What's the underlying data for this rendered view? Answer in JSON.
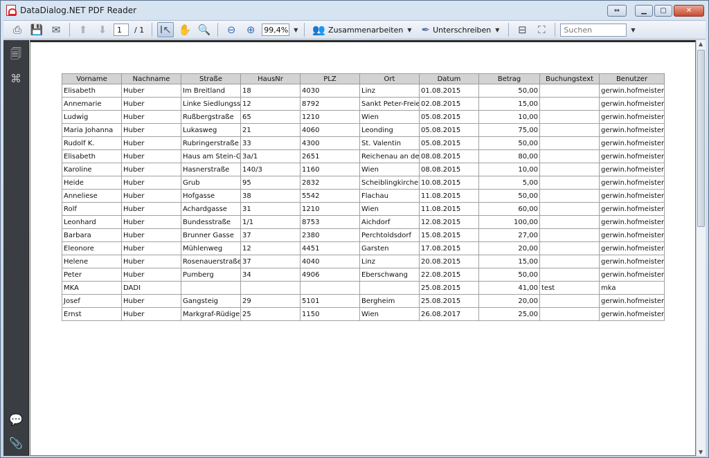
{
  "window": {
    "title": "DataDialog.NET PDF Reader"
  },
  "toolbar": {
    "page_current": "1",
    "page_total": "/ 1",
    "zoom": "99,4%",
    "collaborate_label": "Zusammenarbeiten",
    "sign_label": "Unterschreiben",
    "search_placeholder": "Suchen"
  },
  "table": {
    "headers": [
      "Vorname",
      "Nachname",
      "Straße",
      "HausNr",
      "PLZ",
      "Ort",
      "Datum",
      "Betrag",
      "Buchungstext",
      "Benutzer"
    ],
    "rows": [
      [
        "Elisabeth",
        "Huber",
        "Im Breitland",
        "18",
        "4030",
        "Linz",
        "01.08.2015",
        "50,00",
        "",
        "gerwin.hofmeister"
      ],
      [
        "Annemarie",
        "Huber",
        "Linke Siedlungsstr",
        "12",
        "8792",
        "Sankt Peter-Freien",
        "02.08.2015",
        "15,00",
        "",
        "gerwin.hofmeister"
      ],
      [
        "Ludwig",
        "Huber",
        "Rußbergstraße",
        "65",
        "1210",
        "Wien",
        "05.08.2015",
        "10,00",
        "",
        "gerwin.hofmeister"
      ],
      [
        "Maria Johanna",
        "Huber",
        "Lukasweg",
        "21",
        "4060",
        "Leonding",
        "05.08.2015",
        "75,00",
        "",
        "gerwin.hofmeister"
      ],
      [
        "Rudolf K.",
        "Huber",
        "Rubringerstraße",
        "33",
        "4300",
        "St. Valentin",
        "05.08.2015",
        "50,00",
        "",
        "gerwin.hofmeister"
      ],
      [
        "Elisabeth",
        "Huber",
        "Haus am Stein-Ga",
        "3a/1",
        "2651",
        "Reichenau an der",
        "08.08.2015",
        "80,00",
        "",
        "gerwin.hofmeister"
      ],
      [
        "Karoline",
        "Huber",
        "Hasnerstraße",
        "140/3",
        "1160",
        "Wien",
        "08.08.2015",
        "10,00",
        "",
        "gerwin.hofmeister"
      ],
      [
        "Heide",
        "Huber",
        "Grub",
        "95",
        "2832",
        "Scheiblingkirchen-",
        "10.08.2015",
        "5,00",
        "",
        "gerwin.hofmeister"
      ],
      [
        "Anneliese",
        "Huber",
        "Hofgasse",
        "38",
        "5542",
        "Flachau",
        "11.08.2015",
        "50,00",
        "",
        "gerwin.hofmeister"
      ],
      [
        "Rolf",
        "Huber",
        "Achardgasse",
        "31",
        "1210",
        "Wien",
        "11.08.2015",
        "60,00",
        "",
        "gerwin.hofmeister"
      ],
      [
        "Leonhard",
        "Huber",
        "Bundesstraße",
        "1/1",
        "8753",
        "Aichdorf",
        "12.08.2015",
        "100,00",
        "",
        "gerwin.hofmeister"
      ],
      [
        "Barbara",
        "Huber",
        "Brunner Gasse",
        "37",
        "2380",
        "Perchtoldsdorf",
        "15.08.2015",
        "27,00",
        "",
        "gerwin.hofmeister"
      ],
      [
        "Eleonore",
        "Huber",
        "Mühlenweg",
        "12",
        "4451",
        "Garsten",
        "17.08.2015",
        "20,00",
        "",
        "gerwin.hofmeister"
      ],
      [
        "Helene",
        "Huber",
        "Rosenauerstraße",
        "37",
        "4040",
        "Linz",
        "20.08.2015",
        "15,00",
        "",
        "gerwin.hofmeister"
      ],
      [
        "Peter",
        "Huber",
        "Pumberg",
        "34",
        "4906",
        "Eberschwang",
        "22.08.2015",
        "50,00",
        "",
        "gerwin.hofmeister"
      ],
      [
        "MKA",
        "DADI",
        "",
        "",
        "",
        "",
        "25.08.2015",
        "41,00",
        "test",
        "mka"
      ],
      [
        "Josef",
        "Huber",
        "Gangsteig",
        "29",
        "5101",
        "Bergheim",
        "25.08.2015",
        "20,00",
        "",
        "gerwin.hofmeister"
      ],
      [
        "Ernst",
        "Huber",
        "Markgraf-Rüdiger-",
        "25",
        "1150",
        "Wien",
        "26.08.2017",
        "25,00",
        "",
        "gerwin.hofmeister"
      ]
    ]
  }
}
